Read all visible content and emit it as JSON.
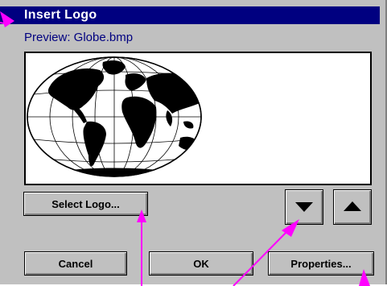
{
  "window": {
    "title": "Insert Logo"
  },
  "preview": {
    "label": "Preview:  Globe.bmp",
    "image_icon": "globe-icon"
  },
  "buttons": {
    "select_logo": "Select Logo...",
    "cancel": "Cancel",
    "ok": "OK",
    "properties": "Properties...",
    "move_down_icon": "arrow-down-icon",
    "move_up_icon": "arrow-up-icon"
  },
  "colors": {
    "titlebar": "#000080",
    "dialog_bg": "#c0c0c0",
    "callout": "#ff00ff"
  }
}
